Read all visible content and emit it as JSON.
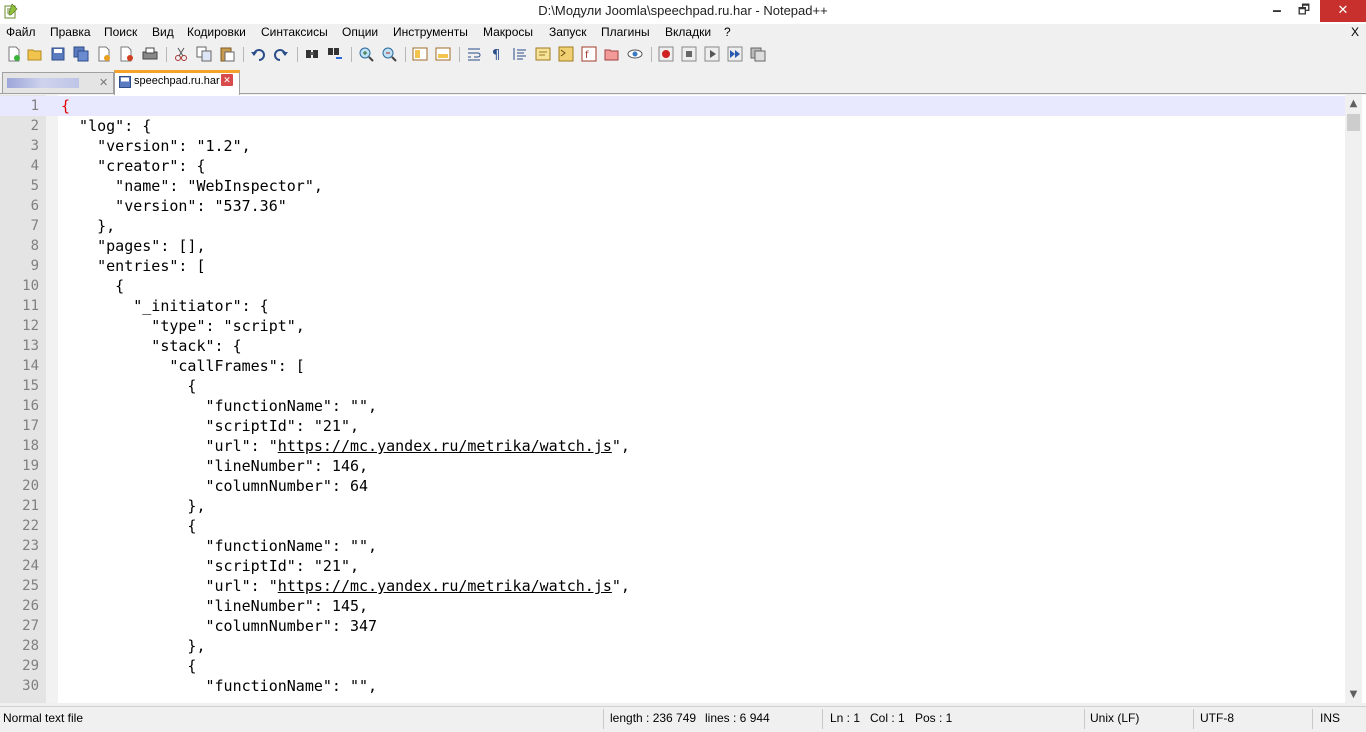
{
  "window": {
    "title": "D:\\Модули Joomla\\speechpad.ru.har - Notepad++",
    "minimize": "🗕",
    "maximize": "🗗",
    "close": "✕"
  },
  "menu": {
    "items": [
      "Файл",
      "Правка",
      "Поиск",
      "Вид",
      "Кодировки",
      "Синтаксисы",
      "Опции",
      "Инструменты",
      "Макросы",
      "Запуск",
      "Плагины",
      "Вкладки",
      "?"
    ],
    "close_doc": "X"
  },
  "toolbar": {
    "icons": [
      "new-file",
      "open-file",
      "save",
      "save-all",
      "close",
      "close-all",
      "print",
      "cut",
      "copy",
      "paste",
      "undo",
      "redo",
      "find",
      "replace",
      "zoom-in",
      "zoom-out",
      "sync-v",
      "sync-h",
      "word-wrap",
      "all-chars",
      "indent-guide",
      "udl",
      "doc-map",
      "function-list",
      "folder-workspace",
      "monitoring",
      "record-macro",
      "stop-macro",
      "play-macro",
      "run-macro-multiple",
      "save-macro"
    ]
  },
  "tabs": [
    {
      "label": "",
      "close": "✕",
      "active": false
    },
    {
      "label": "speechpad.ru.har",
      "close": "✕",
      "active": true
    }
  ],
  "editor": {
    "lines": [
      {
        "n": "1",
        "text": "{"
      },
      {
        "n": "2",
        "text": "  \"log\": {"
      },
      {
        "n": "3",
        "text": "    \"version\": \"1.2\","
      },
      {
        "n": "4",
        "text": "    \"creator\": {"
      },
      {
        "n": "5",
        "text": "      \"name\": \"WebInspector\","
      },
      {
        "n": "6",
        "text": "      \"version\": \"537.36\""
      },
      {
        "n": "7",
        "text": "    },"
      },
      {
        "n": "8",
        "text": "    \"pages\": [],"
      },
      {
        "n": "9",
        "text": "    \"entries\": ["
      },
      {
        "n": "10",
        "text": "      {"
      },
      {
        "n": "11",
        "text": "        \"_initiator\": {"
      },
      {
        "n": "12",
        "text": "          \"type\": \"script\","
      },
      {
        "n": "13",
        "text": "          \"stack\": {"
      },
      {
        "n": "14",
        "text": "            \"callFrames\": ["
      },
      {
        "n": "15",
        "text": "              {"
      },
      {
        "n": "16",
        "text": "                \"functionName\": \"\","
      },
      {
        "n": "17",
        "text": "                \"scriptId\": \"21\","
      },
      {
        "n": "18",
        "pre": "                \"url\": \"",
        "link": "https://mc.yandex.ru/metrika/watch.js",
        "post": "\","
      },
      {
        "n": "19",
        "text": "                \"lineNumber\": 146,"
      },
      {
        "n": "20",
        "text": "                \"columnNumber\": 64"
      },
      {
        "n": "21",
        "text": "              },"
      },
      {
        "n": "22",
        "text": "              {"
      },
      {
        "n": "23",
        "text": "                \"functionName\": \"\","
      },
      {
        "n": "24",
        "text": "                \"scriptId\": \"21\","
      },
      {
        "n": "25",
        "pre": "                \"url\": \"",
        "link": "https://mc.yandex.ru/metrika/watch.js",
        "post": "\","
      },
      {
        "n": "26",
        "text": "                \"lineNumber\": 145,"
      },
      {
        "n": "27",
        "text": "                \"columnNumber\": 347"
      },
      {
        "n": "28",
        "text": "              },"
      },
      {
        "n": "29",
        "text": "              {"
      },
      {
        "n": "30",
        "text": "                \"functionName\": \"\","
      }
    ]
  },
  "status": {
    "file_type": "Normal text file",
    "length": "length : 236 749",
    "lines": "lines : 6 944",
    "ln": "Ln : 1",
    "col": "Col : 1",
    "pos": "Pos : 1",
    "eol": "Unix (LF)",
    "encoding": "UTF-8",
    "mode": "INS"
  },
  "colors": {
    "current_line": "#e8e8ff",
    "brace_highlight": "#e00000",
    "tab_accent": "#f4a22a",
    "close_button": "#c7302c"
  }
}
